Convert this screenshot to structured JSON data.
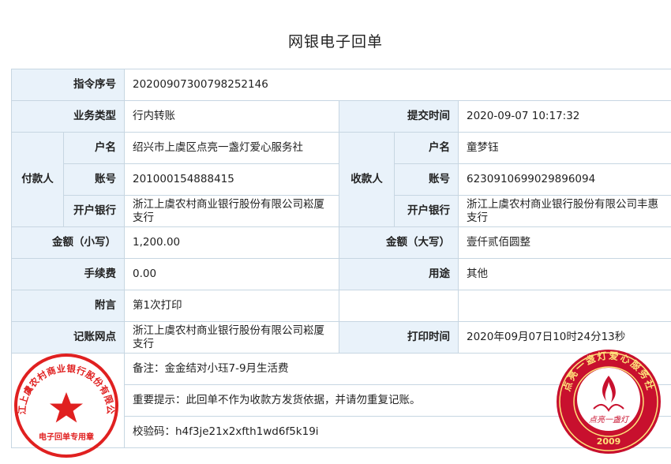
{
  "title": "网银电子回单",
  "rows": {
    "instruction_no": {
      "label": "指令序号",
      "value": "20200907300798252146"
    },
    "business_type": {
      "label": "业务类型",
      "value": "行内转账"
    },
    "submit_time": {
      "label": "提交时间",
      "value": "2020-09-07 10:17:32"
    },
    "payer": {
      "group": "付款人",
      "name_label": "户名",
      "name": "绍兴市上虞区点亮一盏灯爱心服务社",
      "account_label": "账号",
      "account": "201000154888415",
      "bank_label": "开户银行",
      "bank": "浙江上虞农村商业银行股份有限公司崧厦支行"
    },
    "payee": {
      "group": "收款人",
      "name_label": "户名",
      "name": "童梦钰",
      "account_label": "账号",
      "account": "6230910699029896094",
      "bank_label": "开户银行",
      "bank": "浙江上虞农村商业银行股份有限公司丰惠支行"
    },
    "amount_small": {
      "label": "金额（小写）",
      "value": "1,200.00"
    },
    "amount_big": {
      "label": "金额（大写）",
      "value": "壹仟贰佰圆整"
    },
    "fee": {
      "label": "手续费",
      "value": "0.00"
    },
    "usage": {
      "label": "用途",
      "value": "其他"
    },
    "postscript": {
      "label": "附言",
      "value": "第1次打印"
    },
    "branch": {
      "label": "记账网点",
      "value": "浙江上虞农村商业银行股份有限公司崧厦支行"
    },
    "print_time": {
      "label": "打印时间",
      "value": "2020年09月07日10时24分13秒"
    }
  },
  "notes": {
    "remark": "备注：金金结对小珏7-9月生活费",
    "important": "重要提示：此回单不作为收款方发货依据，并请勿重复记账。",
    "verify": "校验码：h4f3je21x2xfth1wd6f5k19i"
  },
  "seals": {
    "bank_seal_text": "浙江上虞农村商业银行股份有限公司",
    "bank_seal_sub": "电子回单专用章",
    "club_seal_text": "点亮一盏灯爱心服务社",
    "club_seal_center": "点亮一盏灯",
    "club_seal_year": "2009",
    "bank_seal_color": "#e02020",
    "club_seal_color": "#c8102e"
  }
}
